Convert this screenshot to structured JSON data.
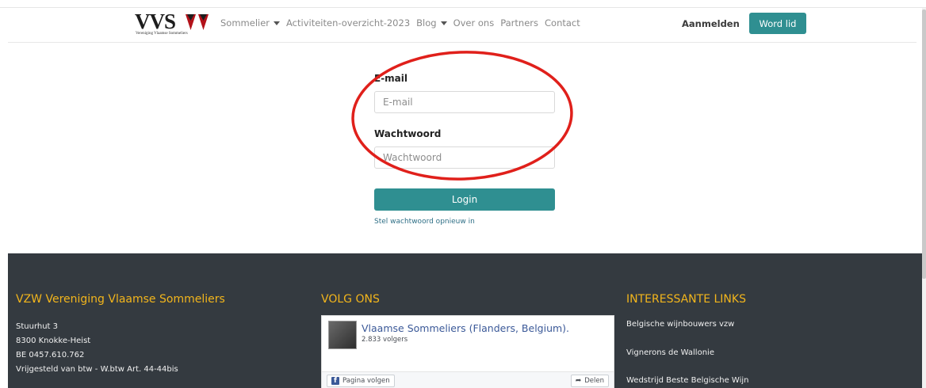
{
  "nav": {
    "logo_text": "VVS",
    "logo_subtitle": "Vereniging Vlaamse Sommeliers",
    "items": [
      {
        "label": "Sommelier",
        "dropdown": true
      },
      {
        "label": "Activiteiten-overzicht-2023",
        "dropdown": false
      },
      {
        "label": "Blog",
        "dropdown": true
      },
      {
        "label": "Over ons",
        "dropdown": false
      },
      {
        "label": "Partners",
        "dropdown": false
      },
      {
        "label": "Contact",
        "dropdown": false
      }
    ],
    "login_label": "Aanmelden",
    "join_label": "Word lid"
  },
  "form": {
    "email_label": "E-mail",
    "email_placeholder": "E-mail",
    "password_label": "Wachtwoord",
    "password_placeholder": "Wachtwoord",
    "submit_label": "Login",
    "reset_link": "Stel wachtwoord opnieuw in"
  },
  "footer": {
    "org_title": "VZW Vereniging Vlaamse Sommeliers",
    "address_lines": [
      "Stuurhut 3",
      "8300 Knokke-Heist",
      "BE 0457.610.762",
      "Vrijgesteld van btw - W.btw Art. 44-44bis"
    ],
    "follow_title": "VOLG ONS",
    "fb": {
      "page_name": "Vlaamse Sommeliers (Flanders, Belgium).",
      "followers": "2.833 volgers",
      "follow_label": "Pagina volgen",
      "share_label": "Delen"
    },
    "links_title": "INTERESSANTE LINKS",
    "links": [
      "Belgische wijnbouwers vzw",
      "Vignerons de Wallonie",
      "Wedstrijd Beste Belgische Wijn"
    ]
  },
  "colors": {
    "accent": "#2f8f91",
    "footer_bg": "#343a40",
    "footer_heading": "#f2b51c",
    "annotation": "#e0201b"
  }
}
